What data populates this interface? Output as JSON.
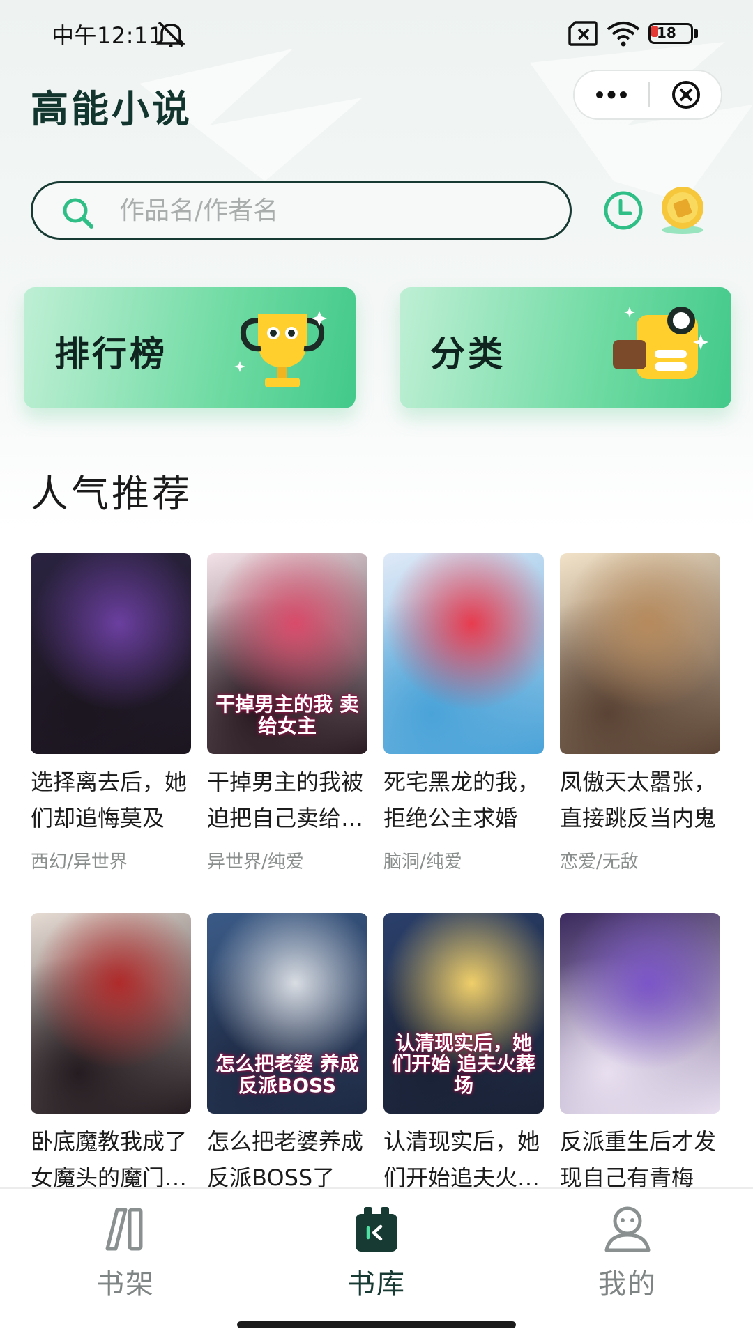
{
  "status_bar": {
    "time": "中午12:11",
    "battery": "18",
    "battery_level": 0.18
  },
  "header": {
    "app_title": "高能小说",
    "capsule_icons": [
      "more-icon",
      "close-icon"
    ]
  },
  "search": {
    "placeholder": "作品名/作者名",
    "icons": [
      "search-icon",
      "history-icon",
      "coin-icon"
    ]
  },
  "features": [
    {
      "label": "排行榜",
      "icon": "trophy-icon"
    },
    {
      "label": "分类",
      "icon": "category-icon"
    }
  ],
  "section_title": "人气推荐",
  "books": [
    {
      "name": "选择离去后，她们却追悔莫及",
      "tags": "西幻/异世界",
      "cover_text": "",
      "palette": [
        "#2a2340",
        "#6b3fa0",
        "#1c1620"
      ]
    },
    {
      "name": "干掉男主的我被迫把自己卖给…",
      "tags": "异世界/纯爱",
      "cover_text": "干掉男主的我 卖给女主",
      "palette": [
        "#f3e3e8",
        "#d94b6a",
        "#2a1a22"
      ]
    },
    {
      "name": "死宅黑龙的我，拒绝公主求婚",
      "tags": "脑洞/纯爱",
      "cover_text": "",
      "palette": [
        "#dfe9f7",
        "#e83b4e",
        "#4aa3d8"
      ]
    },
    {
      "name": "凤傲天太嚣张，直接跳反当内鬼",
      "tags": "恋爱/无敌",
      "cover_text": "",
      "palette": [
        "#f1e2c8",
        "#b68a5c",
        "#5a4334"
      ]
    },
    {
      "name": "卧底魔教我成了女魔头的魔门…",
      "tags": "",
      "cover_text": "",
      "palette": [
        "#e6dcd4",
        "#b02a2a",
        "#241c20"
      ]
    },
    {
      "name": "怎么把老婆养成反派BOSS了",
      "tags": "",
      "cover_text": "怎么把老婆 养成反派BOSS",
      "palette": [
        "#3a5a86",
        "#d9dde3",
        "#1e2a44"
      ]
    },
    {
      "name": "认清现实后，她们开始追夫火…",
      "tags": "",
      "cover_text": "认清现实后，她们开始 追夫火葬场",
      "palette": [
        "#2a3f6a",
        "#f0cf6a",
        "#1a2236"
      ]
    },
    {
      "name": "反派重生后才发现自己有青梅",
      "tags": "",
      "cover_text": "",
      "palette": [
        "#3b2a5e",
        "#7b55c8",
        "#e8dff0"
      ]
    }
  ],
  "nav": [
    {
      "label": "书架",
      "icon": "bookshelf-icon",
      "active": false
    },
    {
      "label": "书库",
      "icon": "library-icon",
      "active": true
    },
    {
      "label": "我的",
      "icon": "profile-icon",
      "active": false
    }
  ],
  "colors": {
    "accent_dark": "#173a32",
    "accent_green": "#42c98a",
    "tag_gray": "#8a8f8e"
  }
}
